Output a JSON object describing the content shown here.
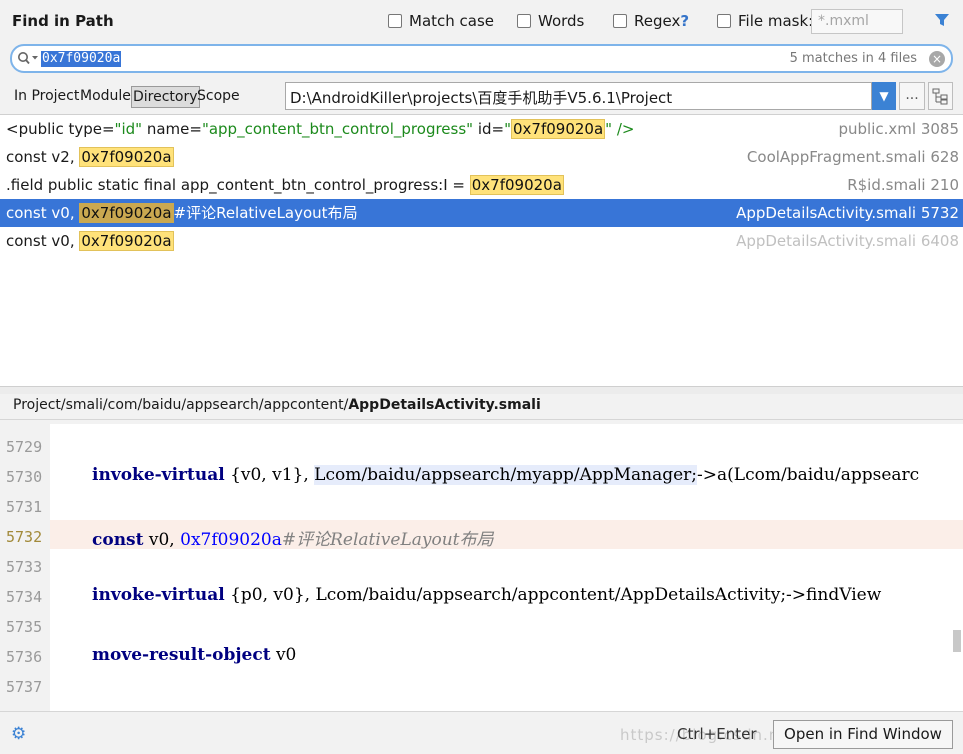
{
  "header": {
    "title": "Find in Path",
    "options": {
      "match_case": "Match case",
      "words": "Words",
      "regex": "Regex",
      "regex_help": "?",
      "file_mask": "File mask:",
      "file_mask_placeholder": "*.mxml"
    }
  },
  "search": {
    "query": "0x7f09020a",
    "matches": "5 matches in 4 files",
    "clear": "×"
  },
  "scope": {
    "in_project": "In Project",
    "module": "Module",
    "directory": "Directory",
    "scope": "Scope",
    "selected": "Directory",
    "directory_path": "D:\\AndroidKiller\\projects\\百度手机助手V5.6.1\\Project",
    "more": "...",
    "dropdown": "▼"
  },
  "results": [
    {
      "parts": [
        "<public type=",
        "\"id\"",
        " name=",
        "\"app_content_btn_control_progress\"",
        " id=",
        "\"",
        "0x7f09020a",
        "\" />"
      ],
      "file": "public.xml 3085"
    },
    {
      "parts": [
        "const v2, ",
        "0x7f09020a"
      ],
      "file": "CoolAppFragment.smali 628"
    },
    {
      "parts": [
        ".field public static final app_content_btn_control_progress:I = ",
        "0x7f09020a"
      ],
      "file": "R$id.smali 210"
    },
    {
      "parts": [
        "const v0, ",
        "0x7f09020a",
        "#评论RelativeLayout布局"
      ],
      "file": "AppDetailsActivity.smali 5732",
      "selected": true
    },
    {
      "parts": [
        "const v0, ",
        "0x7f09020a"
      ],
      "file": "AppDetailsActivity.smali 6408"
    }
  ],
  "preview": {
    "path_prefix": "Project/smali/com/baidu/appsearch/appcontent/",
    "path_file": "AppDetailsActivity.smali",
    "line_numbers": [
      "5729",
      "5730",
      "5731",
      "5732",
      "5733",
      "5734",
      "5735",
      "5736",
      "5737"
    ],
    "current_line": "5732",
    "code": {
      "l5730_kw": "invoke-virtual",
      "l5730_regs": " {v0, v1}, ",
      "l5730_ref": "Lcom/baidu/appsearch/myapp/AppManager;",
      "l5730_rest": "->a(Lcom/baidu/appsearc",
      "l5732_kw": "const",
      "l5732_reg": " v0, ",
      "l5732_num": "0x7f09020a",
      "l5732_cmt": "#评论RelativeLayout布局",
      "l5734_kw": "invoke-virtual",
      "l5734_rest": " {p0, v0}, Lcom/baidu/appsearch/appcontent/AppDetailsActivity;->findView",
      "l5736_kw": "move-result-object",
      "l5736_rest": " v0"
    }
  },
  "footer": {
    "shortcut": "Ctrl+Enter",
    "open_button": "Open in Find Window",
    "watermark": "https://blog.csdn.net/..."
  },
  "colors": {
    "selection": "#3875d7",
    "highlight": "#ffe27a",
    "current_line": "#fbeee8"
  }
}
